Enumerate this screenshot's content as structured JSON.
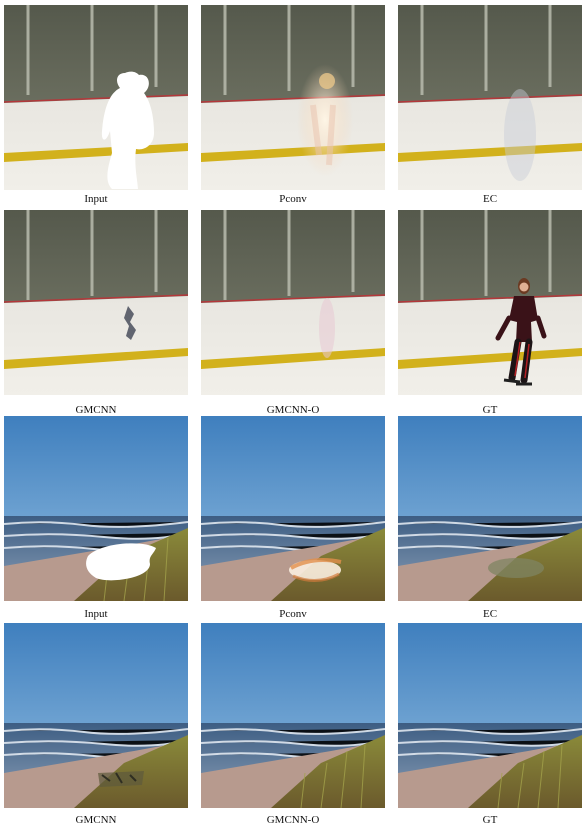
{
  "rows": [
    {
      "scene": "rink",
      "captions": [
        "Input",
        "Pconv",
        "EC"
      ]
    },
    {
      "scene": "rink",
      "captions": [
        "GMCNN",
        "GMCNN-O",
        "GT"
      ]
    },
    {
      "scene": "beach",
      "captions": [
        "Input",
        "Pconv",
        "EC"
      ]
    },
    {
      "scene": "beach",
      "captions": [
        "GMCNN",
        "GMCNN-O",
        "GT"
      ]
    }
  ]
}
